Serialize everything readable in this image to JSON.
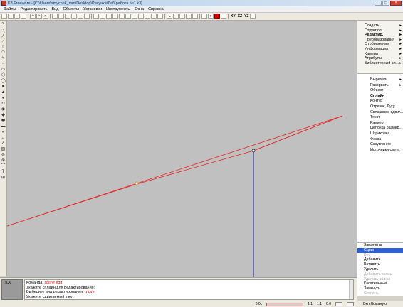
{
  "window": {
    "title": "K3 Freeware - [C:\\Users\\smychek_mm\\Desktop\\Рисунки\\Лаб.работа №1.k3]"
  },
  "menu": [
    "Файлы",
    "Редактировать",
    "Вид",
    "Объекты",
    "Установки",
    "Инструменты",
    "Окна",
    "Справка"
  ],
  "toolbar": {
    "labels": [
      "XY",
      "XZ",
      "YZ"
    ]
  },
  "side_menu": [
    {
      "label": "Создать",
      "arrow": "▸"
    },
    {
      "label": "Структ.оп.",
      "arrow": "▸"
    },
    {
      "label": "Редактир.",
      "arrow": "▸",
      "bold": true
    },
    {
      "label": "Преобразования",
      "arrow": "▸"
    },
    {
      "label": "Отображение",
      "arrow": "▸"
    },
    {
      "label": "Информация",
      "arrow": "▸"
    },
    {
      "label": "Камера",
      "arrow": "▸"
    },
    {
      "label": "Атрибуты",
      "arrow": "▸"
    },
    {
      "label": "Библиотечный эл...",
      "arrow": "▸"
    }
  ],
  "edit_submenu": [
    {
      "label": "Вырезать",
      "arrow": "▸"
    },
    {
      "label": "Разорвать",
      "arrow": "▸"
    },
    {
      "label": "Объект",
      "arrow": ""
    },
    {
      "label": "Сплайн",
      "arrow": "",
      "bold": true
    },
    {
      "label": "Контур",
      "arrow": ""
    },
    {
      "label": "Отрезок, Дугу",
      "arrow": ""
    },
    {
      "label": "Связанное сдвиг...",
      "arrow": ""
    },
    {
      "label": "Текст",
      "arrow": ""
    },
    {
      "label": "Размер",
      "arrow": ""
    },
    {
      "label": "Цепочка размер...",
      "arrow": ""
    },
    {
      "label": "Штриховка",
      "arrow": ""
    },
    {
      "label": "Фаска",
      "arrow": ""
    },
    {
      "label": "Скругление",
      "arrow": ""
    },
    {
      "label": "Источники света",
      "arrow": ""
    }
  ],
  "command_options": [
    {
      "label": "Закончить",
      "state": "normal"
    },
    {
      "label": "Сдвиг",
      "state": "selected"
    },
    {
      "label": "Вес",
      "state": "disabled"
    },
    {
      "label": "Добавить",
      "state": "normal"
    },
    {
      "label": "Вставить",
      "state": "normal"
    },
    {
      "label": "Удалить",
      "state": "normal"
    },
    {
      "label": "Добавить волны",
      "state": "disabled"
    },
    {
      "label": "Удалить волны",
      "state": "disabled"
    },
    {
      "label": "Касательные",
      "state": "normal"
    },
    {
      "label": "Замкнуть",
      "state": "normal"
    },
    {
      "label": "Степень",
      "state": "disabled"
    }
  ],
  "right_status": "Вкл.Ломаную",
  "command_log": {
    "thumbnail_label": "ПСК",
    "lines": [
      {
        "prefix": "Команда: ",
        "value": "spline edit"
      },
      {
        "prefix": "Укажите сплайн для редактирования:",
        "value": ""
      },
      {
        "prefix": "Выберите вид редактирования: ",
        "value": "move"
      },
      {
        "prefix": "Укажите сдвигаемый узел:",
        "value": ""
      }
    ]
  },
  "status": {
    "value": "0.0с",
    "scale1": "1:1",
    "scale2": "1:1",
    "scale3": "0:0"
  },
  "colors": {
    "canvas": "#c0c0c0",
    "spline": "#e02a2a",
    "axis": "#1a1aa0",
    "selected": "#2f5fd0"
  },
  "icons": {
    "left_tools": [
      "select-arrow-icon",
      "line-icon",
      "polyline-icon",
      "circle-icon",
      "arc-icon",
      "rectangle-icon",
      "spline-icon",
      "text-icon",
      "dimension-icon",
      "hatch-icon"
    ]
  }
}
